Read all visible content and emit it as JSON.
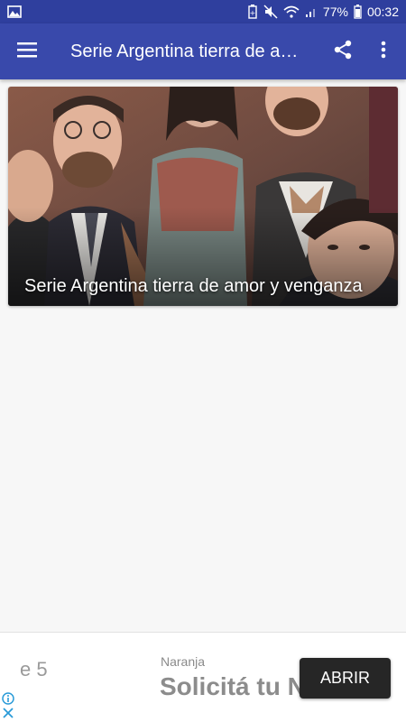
{
  "status_bar": {
    "battery": "77%",
    "time": "00:32",
    "icons": [
      "image-notification-icon",
      "battery-saver-icon",
      "mute-icon",
      "wifi-icon",
      "signal-icon",
      "battery-icon"
    ]
  },
  "app_bar": {
    "title": "Serie Argentina tierra de amor y venganza",
    "menu_icon": "hamburger-menu-icon",
    "share_icon": "share-icon",
    "more_icon": "more-vert-icon"
  },
  "feed": {
    "items": [
      {
        "title": "Serie Argentina tierra de amor y venganza"
      }
    ]
  },
  "ad": {
    "left_text": "e 5",
    "advertiser": "Naranja",
    "headline": "Solicitá tu N",
    "cta": "ABRIR"
  },
  "colors": {
    "status_bar": "#2f3f9e",
    "app_bar": "#3949ab",
    "background": "#f7f7f7",
    "ad_cta": "#262626"
  }
}
